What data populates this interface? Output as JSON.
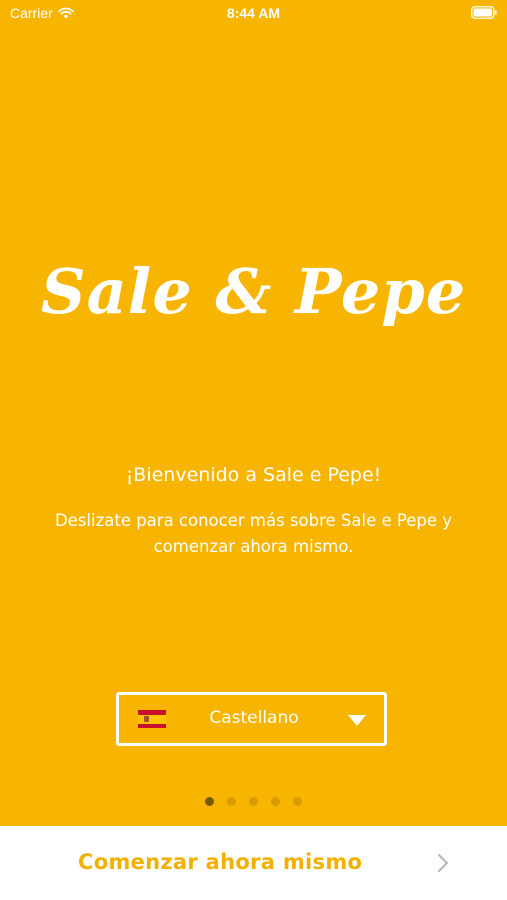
{
  "status_bar": {
    "carrier": "Carrier",
    "time": "8:44 AM",
    "icons": [
      "wifi-icon",
      "battery-icon"
    ]
  },
  "logo": {
    "text": "Sale & Pepe"
  },
  "welcome": {
    "title": "¡Bienvenido a Sale e Pepe!",
    "subtitle": "Deslizate para conocer más sobre Sale e Pepe y comenzar ahora mismo."
  },
  "language": {
    "selected": "Castellano",
    "flag_icon": "spain-flag-icon",
    "dropdown_icon": "caret-down-icon"
  },
  "pager": {
    "total": 5,
    "active_index": 0
  },
  "cta": {
    "label": "Comenzar ahora mismo",
    "icon": "chevron-right-icon"
  },
  "colors": {
    "background": "#F7B400",
    "cta_text": "#F2B100",
    "dot_inactive": "#D89C00",
    "dot_active": "#7A5A00"
  }
}
